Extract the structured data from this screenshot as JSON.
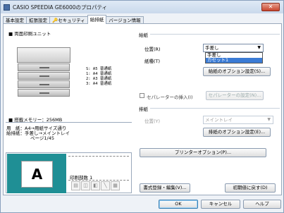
{
  "window": {
    "title": "CASIO SPEEDIA GE6000のプロパティ"
  },
  "tabs": [
    "基本設定",
    "拡張設定",
    "セキュリティ",
    "給排紙",
    "バージョン情報"
  ],
  "left": {
    "unit_heading": "■ 両面印刷ユニット",
    "trays": [
      "S: A5 普通紙",
      "1: A4 普通紙",
      "2: A3 普通紙",
      "3: A4 普通紙"
    ],
    "memory": "■ 搭載メモリー：256MB",
    "info_lines": [
      "用　紙：A4→用紙サイズ通り",
      "給排紙：手差し→メイントレイ",
      "ページ1/45"
    ],
    "print_count": "印刷部数 1"
  },
  "feed": {
    "heading": "給紙",
    "position_label": "位置(R)",
    "position_value": "手差し",
    "dropdown_items": [
      "手差し",
      "カセット1"
    ],
    "type_label": "紙種(T)",
    "option_button": "給紙のオプション設定(S)..."
  },
  "separator": {
    "checkbox_label": "セパレーターの挿入(I)",
    "settings_button": "セパレーターの設定(N)..."
  },
  "output": {
    "heading": "排紙",
    "position_label": "位置(Y)",
    "position_value": "メイントレイ",
    "option_button": "排紙のオプション設定(E)..."
  },
  "printer_options_button": "プリンターオプション(P)...",
  "bottom": {
    "register_button": "書式登録・編集(V)...",
    "reset_button": "初期値に戻す(D)"
  },
  "footer": {
    "ok": "OK",
    "cancel": "キャンセル",
    "help": "ヘルプ"
  }
}
